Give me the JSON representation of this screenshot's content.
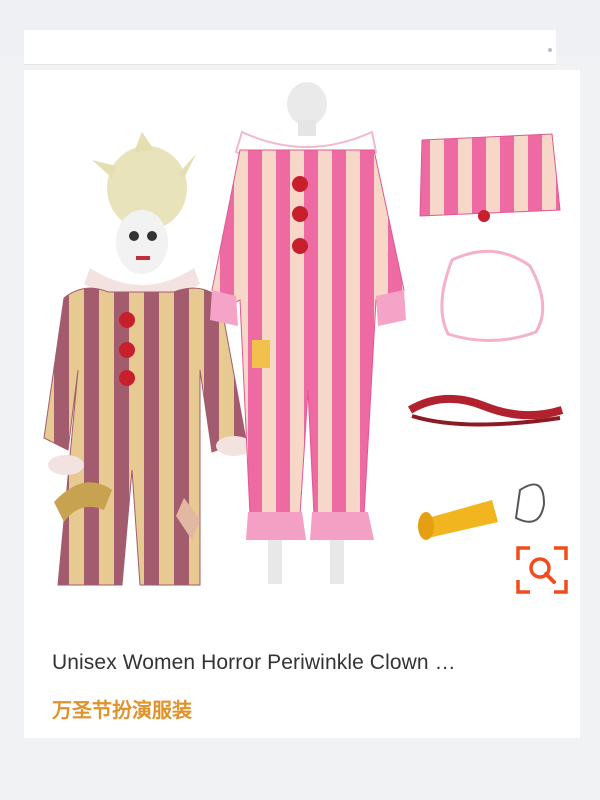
{
  "product": {
    "title": "Unisex Women Horror Periwinkle Clown …",
    "subtitle": "万圣节扮演服装"
  },
  "icons": {
    "image_search": "image-search-icon"
  },
  "colors": {
    "subtitle": "#e0922a",
    "search_icon": "#f04c1e",
    "title": "#333333"
  }
}
